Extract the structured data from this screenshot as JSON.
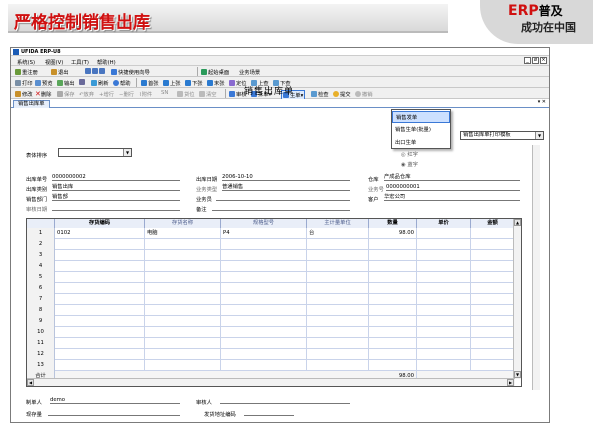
{
  "slide": {
    "title": "严格控制销售出库",
    "brand_erp": "ERP",
    "brand_suffix": "普及",
    "brand_line2": "成功在中国"
  },
  "window": {
    "app_title": "UFIDA ERP-U8",
    "controls": [
      "_",
      "ø",
      "×"
    ]
  },
  "menu": [
    "系统(S)",
    "视图(V)",
    "工具(T)",
    "帮助(H)"
  ],
  "toolbar1": [
    "重注册",
    "退出",
    "快捷使用向导",
    "起始桌面",
    "业务场景"
  ],
  "toolbar2": [
    "打印",
    "预览",
    "输出",
    "刷新",
    "帮助",
    "首张",
    "上张",
    "下张",
    "末张",
    "定位",
    "上查",
    "下查"
  ],
  "toolbar3": [
    "修改",
    "删除",
    "保存",
    "放弃",
    "增行",
    "删行",
    "附件",
    "SN",
    "货位",
    "清空",
    "审核",
    "拆单",
    "生单",
    "检查",
    "提交",
    "撤销"
  ],
  "tab": {
    "label": "销售出库单"
  },
  "form": {
    "title": "销售出库单",
    "print_template": "销售出库单打印模板",
    "sort_label": "表体排序",
    "red": "红字",
    "blue": "蓝字",
    "fields": {
      "out_no_label": "出库单号",
      "out_no": "0000000002",
      "out_date_label": "出库日期",
      "out_date": "2006-10-10",
      "warehouse_label": "仓库",
      "warehouse": "产成品仓库",
      "out_type_label": "出库类别",
      "out_type": "销售出库",
      "biz_type_label": "业务类型",
      "biz_type": "普通销售",
      "biz_no_label": "业务号",
      "biz_no": "0000000001",
      "dept_label": "销售部门",
      "dept": "销售部",
      "clerk_label": "业务员",
      "clerk": "",
      "customer_label": "客户",
      "customer": "华宏公司",
      "audit_date_label": "审核日期",
      "audit_date": "",
      "remark_label": "备注",
      "remark": ""
    }
  },
  "dropdown": {
    "items": [
      "销售发单",
      "销售生单(批量)",
      "出口生单"
    ]
  },
  "grid": {
    "columns": [
      "存货编码",
      "存货名称",
      "规格型号",
      "主计量单位",
      "数量",
      "单价",
      "金额"
    ],
    "rows": [
      {
        "n": "1",
        "code": "0102",
        "name": "电脑",
        "spec": "P4",
        "unit": "台",
        "qty": "98.00",
        "price": "",
        "amount": ""
      },
      {
        "n": "2"
      },
      {
        "n": "3"
      },
      {
        "n": "4"
      },
      {
        "n": "5"
      },
      {
        "n": "6"
      },
      {
        "n": "7"
      },
      {
        "n": "8"
      },
      {
        "n": "9"
      },
      {
        "n": "10"
      },
      {
        "n": "11"
      },
      {
        "n": "12"
      },
      {
        "n": "13"
      }
    ],
    "total_label": "合计",
    "total_qty": "98.00"
  },
  "footer": {
    "maker_label": "制单人",
    "maker": "demo",
    "auditor_label": "审核人",
    "auditor": "",
    "stock_label": "现存量",
    "ship_addr_label": "发货地址编码"
  }
}
